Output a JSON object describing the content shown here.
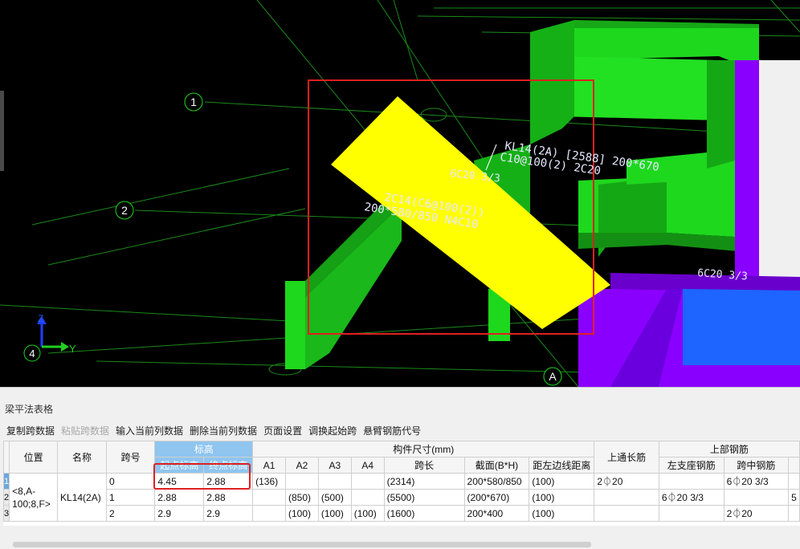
{
  "viewport": {
    "axis_bubbles": [
      "1",
      "2",
      "4",
      "A"
    ],
    "beam_label_line1": "KL14(2A) [2588] 200*670",
    "beam_label_line2": "C10@100(2) 2C20",
    "rebar_label_upper": "6C20 3/3",
    "rebar_label_right": "6C20 3/3",
    "yellow_label_line1": "2C14(C6@100(2))",
    "yellow_label_line2": "200*580/850 N4C10",
    "triad": {
      "z": "Z",
      "y": "Y",
      "origin": "4"
    },
    "colors": {
      "background": "#000000",
      "green_beam": "#1ed81e",
      "yellow_beam": "#ffff00",
      "purple_column": "#8a00ff",
      "blue_beam": "#1e64ff",
      "red_box": "#e02020"
    }
  },
  "panel": {
    "title": "梁平法表格",
    "toolbar": [
      "复制跨数据",
      "粘贴跨数据",
      "输入当前列数据",
      "删除当前列数据",
      "页面设置",
      "调换起始跨",
      "悬臂钢筋代号"
    ],
    "toolbar_disabled": [
      1
    ],
    "headers": {
      "position": "位置",
      "name": "名称",
      "span": "跨号",
      "elevation": "标高",
      "start_elev": "起点标高",
      "end_elev": "终点标高",
      "dimensions": "构件尺寸(mm)",
      "a1": "A1",
      "a2": "A2",
      "a3": "A3",
      "a4": "A4",
      "span_length": "跨长",
      "section": "截面(B*H)",
      "dist_left": "距左边线距离",
      "top_through": "上通长筋",
      "top_rebar": "上部钢筋",
      "left_support": "左支座钢筋",
      "mid_span": "跨中钢筋"
    },
    "rows": [
      {
        "num": "1",
        "position": "<8,A-100;8,F>",
        "name": "KL14(2A)",
        "span": "0",
        "start_elev": "4.45",
        "end_elev": "2.88",
        "a1": "(136)",
        "a2": "",
        "a3": "",
        "a4": "",
        "span_length": "(2314)",
        "section": "200*580/850",
        "dist_left": "(100)",
        "top_through": "2⏀20",
        "left_support": "",
        "mid_span": "6⏀20 3/3",
        "extra": ""
      },
      {
        "num": "2",
        "span": "1",
        "start_elev": "2.88",
        "end_elev": "2.88",
        "a1": "",
        "a2": "(850)",
        "a3": "(500)",
        "a4": "",
        "span_length": "(5500)",
        "section": "(200*670)",
        "dist_left": "(100)",
        "top_through": "",
        "left_support": "6⏀20 3/3",
        "mid_span": "",
        "extra": "5"
      },
      {
        "num": "3",
        "span": "2",
        "start_elev": "2.9",
        "end_elev": "2.9",
        "a1": "",
        "a2": "(100)",
        "a3": "(100)",
        "a4": "(100)",
        "span_length": "(1600)",
        "section": "200*400",
        "dist_left": "(100)",
        "top_through": "",
        "left_support": "",
        "mid_span": "2⏀20",
        "extra": ""
      }
    ]
  }
}
